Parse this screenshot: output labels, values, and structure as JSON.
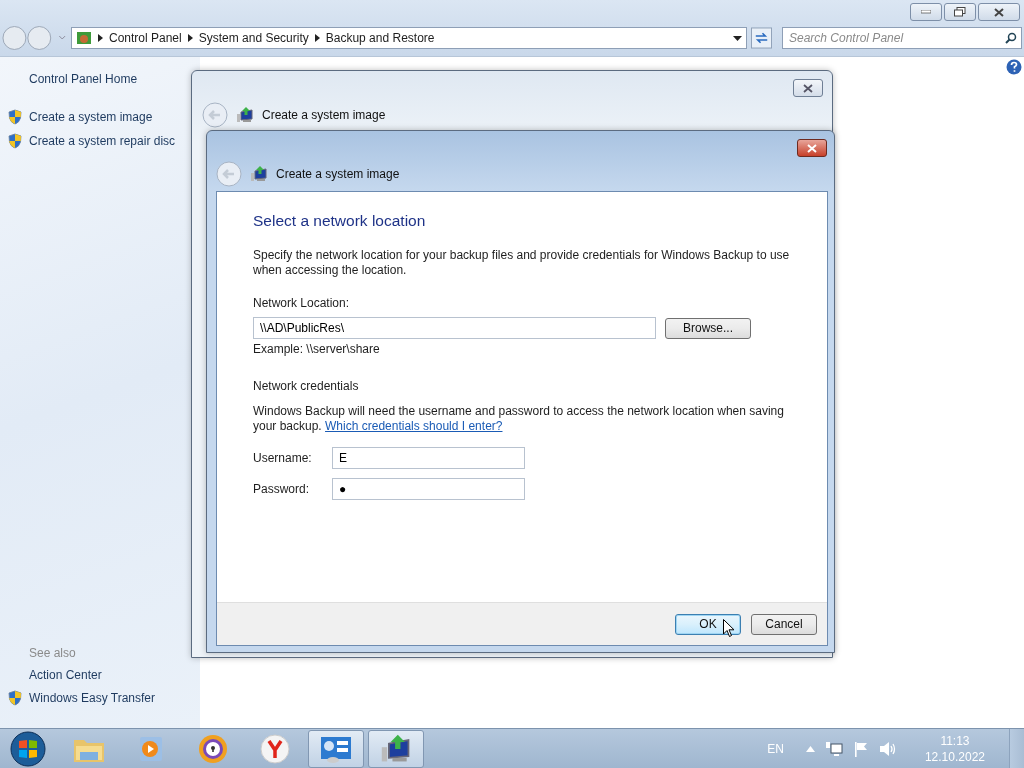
{
  "window": {
    "address_path": [
      "Control Panel",
      "System and Security",
      "Backup and Restore"
    ],
    "search": {
      "placeholder": "Search Control Panel"
    }
  },
  "sidebar": {
    "items": [
      {
        "label": "Control Panel Home",
        "kind": "link"
      },
      {
        "label": "Create a system image",
        "kind": "shield"
      },
      {
        "label": "Create a system repair disc",
        "kind": "shield"
      }
    ],
    "see_also_heading": "See also",
    "see_also": [
      {
        "label": "Action Center",
        "kind": "link"
      },
      {
        "label": "Windows Easy Transfer",
        "kind": "shield"
      }
    ]
  },
  "back_dialog": {
    "title": "Create a system image"
  },
  "dialog": {
    "title": "Create a system image",
    "heading": "Select a network location",
    "intro": "Specify the network location for your backup files and provide credentials for Windows Backup to use when accessing the location.",
    "location_label": "Network Location:",
    "location_value": "\\\\AD\\PublicRes\\",
    "browse_button": "Browse...",
    "example": "Example: \\\\server\\share",
    "credentials_heading": "Network credentials",
    "credentials_text": "Windows Backup will need the username and password to access the network location when saving your backup.",
    "credentials_link": "Which credentials should I enter?",
    "username_label": "Username:",
    "username_value": "E",
    "password_label": "Password:",
    "password_value": "●",
    "buttons": [
      {
        "label": "OK",
        "default": true
      },
      {
        "label": "Cancel",
        "default": false
      }
    ]
  },
  "taskbar": {
    "apps": [
      {
        "kind": "folder",
        "open": false
      },
      {
        "kind": "media",
        "open": false
      },
      {
        "kind": "lockbrowser",
        "open": false
      },
      {
        "kind": "ybrowser",
        "open": false
      },
      {
        "kind": "controlpanel",
        "open": true
      },
      {
        "kind": "backup",
        "open": true
      }
    ],
    "language": "EN",
    "time": "11:13",
    "date": "12.10.2022"
  }
}
